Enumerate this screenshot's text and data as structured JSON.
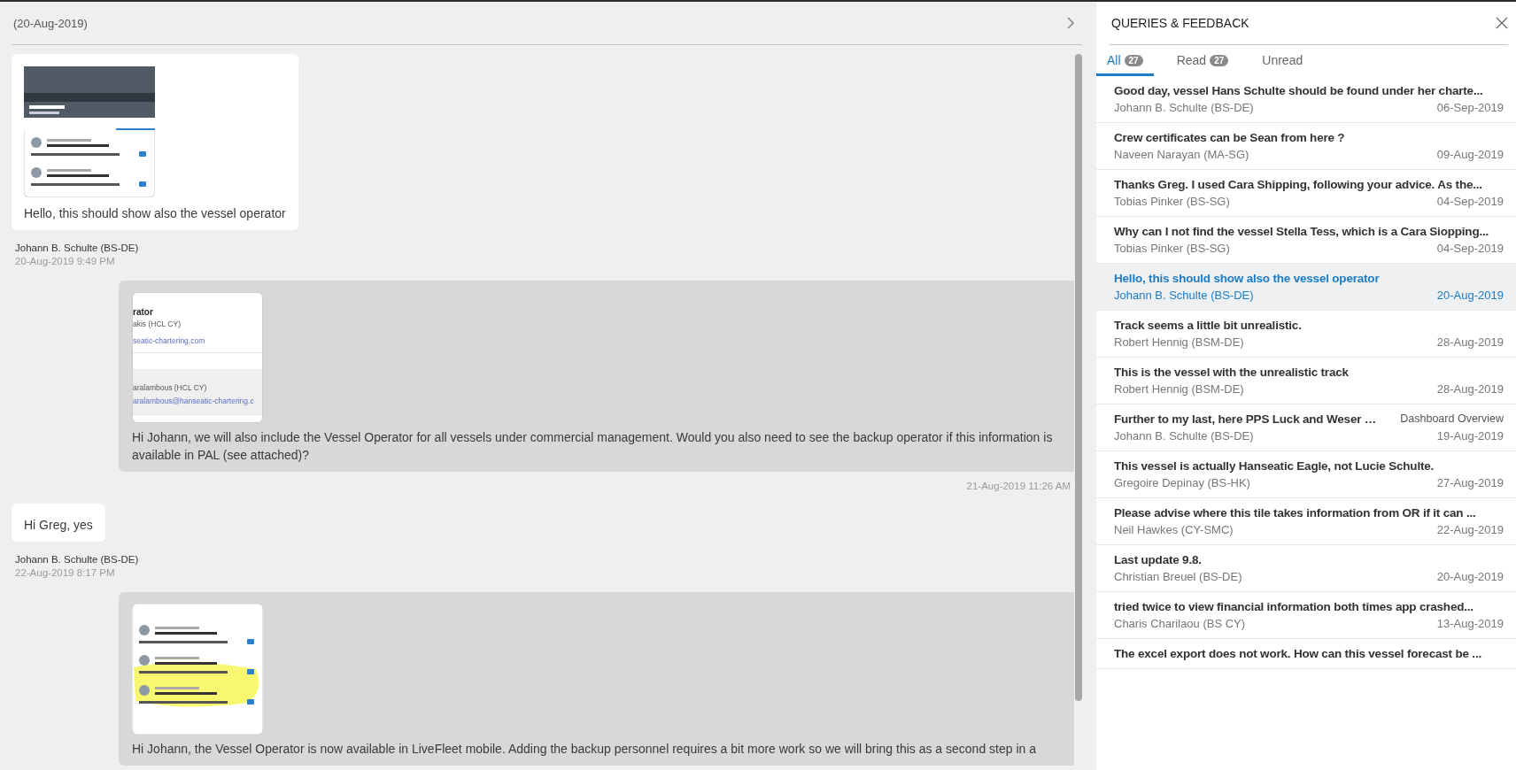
{
  "conversation": {
    "date_header": "(20-Aug-2019)",
    "messages": [
      {
        "kind": "incoming",
        "text": "Hello, this should show also the vessel operator",
        "author": "Johann B. Schulte (BS-DE)",
        "time": "20-Aug-2019 9:49 PM",
        "attachment": {
          "kind": "app-screen"
        }
      },
      {
        "kind": "outgoing",
        "text": "Hi Johann, we will also include the Vessel Operator for all vessels under commercial management. Would you also need to see the backup operator if this information is available in PAL (see attached)?",
        "time": "21-Aug-2019 11:26 AM",
        "attachment": {
          "kind": "zoomed",
          "contacts": [
            {
              "role": "rator",
              "name": "akis (HCL CY)",
              "email": "seatic-chartering.com",
              "shaded": false
            },
            {
              "name": "aralambous (HCL CY)",
              "email": "aralambous@hanseatic-chartering.c",
              "shaded": true
            }
          ]
        }
      },
      {
        "kind": "incoming",
        "text": "Hi Greg, yes",
        "author": "Johann B. Schulte (BS-DE)",
        "time": "22-Aug-2019 8:17 PM"
      },
      {
        "kind": "outgoing",
        "text": "Hi Johann, the Vessel Operator is now available in LiveFleet mobile. Adding the backup personnel requires a bit more work so we will bring this as a second step in a",
        "attachment": {
          "kind": "marked-up"
        }
      }
    ]
  },
  "panel": {
    "title": "QUERIES & FEEDBACK",
    "tabs": [
      {
        "label": "All",
        "count": "27",
        "selected": true
      },
      {
        "label": "Read",
        "count": "27",
        "selected": false
      },
      {
        "label": "Unread",
        "selected": false
      }
    ],
    "items": [
      {
        "title": "Good day, vessel Hans Schulte should be found under her charte...",
        "author": "Johann B. Schulte (BS-DE)",
        "date": "06-Sep-2019",
        "selected": false
      },
      {
        "title": "Crew certificates can be Sean from here ?",
        "author": "Naveen Narayan (MA-SG)",
        "date": "09-Aug-2019",
        "selected": false
      },
      {
        "title": "Thanks Greg. I used Cara Shipping, following your advice. As the...",
        "author": "Tobias Pinker (BS-SG)",
        "date": "04-Sep-2019",
        "selected": false
      },
      {
        "title": "Why can I not find the vessel Stella Tess, which is a Cara Siopping...",
        "author": "Tobias Pinker (BS-SG)",
        "date": "04-Sep-2019",
        "selected": false
      },
      {
        "title": "Hello, this should show also the vessel operator",
        "author": "Johann B. Schulte (BS-DE)",
        "date": "20-Aug-2019",
        "selected": true
      },
      {
        "title": "Track seems a little bit unrealistic.",
        "author": "Robert Hennig (BSM-DE)",
        "date": "28-Aug-2019",
        "selected": false
      },
      {
        "title": "This is the vessel with the unrealistic track",
        "author": "Robert Hennig (BSM-DE)",
        "date": "28-Aug-2019",
        "selected": false
      },
      {
        "title": "Further to my last, here PPS Luck and Weser …",
        "tag": "Dashboard Overview",
        "author": "Johann B. Schulte (BS-DE)",
        "date": "19-Aug-2019",
        "selected": false
      },
      {
        "title": "This vessel is actually Hanseatic Eagle, not Lucie Schulte.",
        "author": "Gregoire Depinay (BS-HK)",
        "date": "27-Aug-2019",
        "selected": false
      },
      {
        "title": "Please advise where this tile takes information from OR if it can ...",
        "author": "Neil Hawkes (CY-SMC)",
        "date": "22-Aug-2019",
        "selected": false
      },
      {
        "title": "Last update 9.8.",
        "author": "Christian Breuel (BS-DE)",
        "date": "20-Aug-2019",
        "selected": false
      },
      {
        "title": "tried twice to view financial information both times app crashed...",
        "author": "Charis Charilaou (BS CY)",
        "date": "13-Aug-2019",
        "selected": false
      },
      {
        "title": "The excel export does not work. How can this vessel forecast be ...",
        "selected": false
      }
    ]
  }
}
